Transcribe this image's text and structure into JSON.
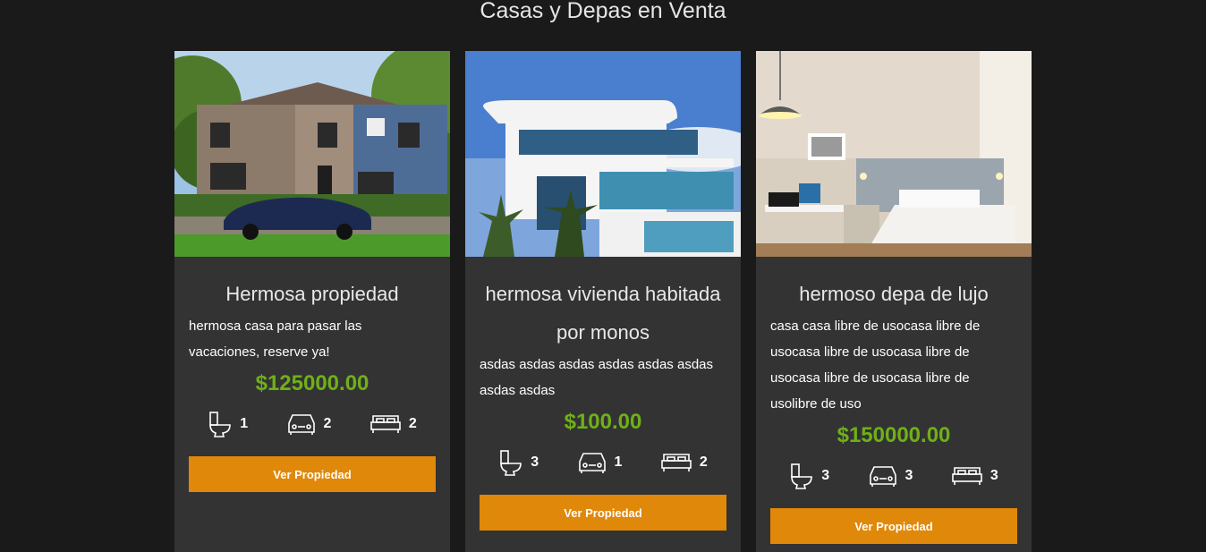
{
  "section": {
    "title": "Casas y Depas en Venta"
  },
  "colors": {
    "background": "#1a1a1a",
    "card": "#333333",
    "price": "#6fb018",
    "button": "#e0880a"
  },
  "properties": [
    {
      "title": "Hermosa propiedad",
      "description": "hermosa casa para pasar las vacaciones, reserve ya!",
      "price": "$125000.00",
      "bathrooms": "1",
      "parking": "2",
      "bedrooms": "2",
      "button_label": "Ver Propiedad",
      "image": "house-with-car-photo"
    },
    {
      "title": "hermosa vivienda habitada por monos",
      "description": "asdas asdas asdas asdas asdas asdas asdas asdas",
      "price": "$100.00",
      "bathrooms": "3",
      "parking": "1",
      "bedrooms": "2",
      "button_label": "Ver Propiedad",
      "image": "modern-white-house-photo"
    },
    {
      "title": "hermoso depa de lujo",
      "description": "casa casa libre de usocasa libre de usocasa libre de usocasa libre de usocasa libre de usocasa libre de usolibre de uso",
      "price": "$150000.00",
      "bathrooms": "3",
      "parking": "3",
      "bedrooms": "3",
      "button_label": "Ver Propiedad",
      "image": "bedroom-photo"
    }
  ]
}
